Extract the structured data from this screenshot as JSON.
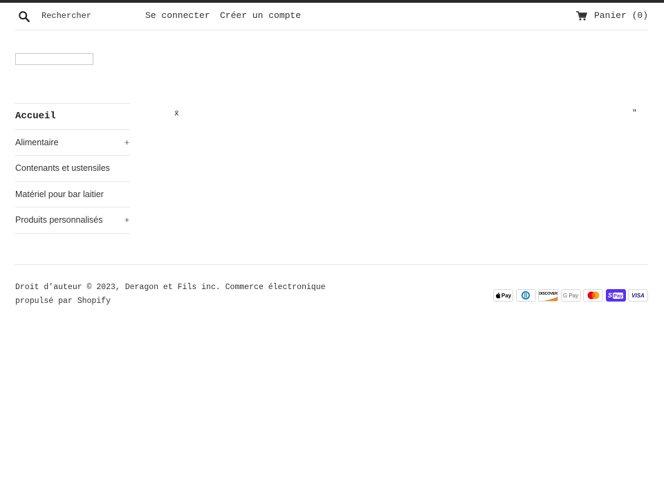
{
  "header": {
    "search_placeholder": "Rechercher",
    "login_label": "Se connecter",
    "register_label": "Créer un compte",
    "cart_label": "Panier",
    "cart_count": "0"
  },
  "sidebar": {
    "items": [
      {
        "label": "Accueil",
        "expandable": false,
        "active": true
      },
      {
        "label": "Alimentaire",
        "expandable": true,
        "toggle": "+"
      },
      {
        "label": "Contenants et ustensiles",
        "expandable": false
      },
      {
        "label": "Matériel pour bar laitier",
        "expandable": false
      },
      {
        "label": "Produits personnalisés",
        "expandable": true,
        "toggle": "+"
      }
    ]
  },
  "carousel": {
    "left_glyph": "x̄",
    "right_glyph": "\""
  },
  "footer": {
    "copyright": "Droit d'auteur © 2023, Deragon et Fils inc. Commerce électronique propulsé par Shopify",
    "payment_methods": [
      {
        "name": "apple-pay",
        "label": "Pay"
      },
      {
        "name": "diners-club",
        "label": ""
      },
      {
        "name": "discover",
        "label": "DISCOVER"
      },
      {
        "name": "google-pay",
        "label": "G Pay"
      },
      {
        "name": "mastercard",
        "label": ""
      },
      {
        "name": "shop-pay",
        "label": "Pay"
      },
      {
        "name": "visa",
        "label": "VISA"
      }
    ]
  },
  "colors": {
    "topbar": "#2b2b2b",
    "text": "#1c1d1d",
    "border": "#e6e6e6",
    "shop_pay": "#5a31f4",
    "visa": "#1a1f71",
    "discover_orange": "#f48120",
    "mastercard_red": "#eb001b",
    "mastercard_yellow": "#f79e1b",
    "diners_blue": "#0079be"
  }
}
